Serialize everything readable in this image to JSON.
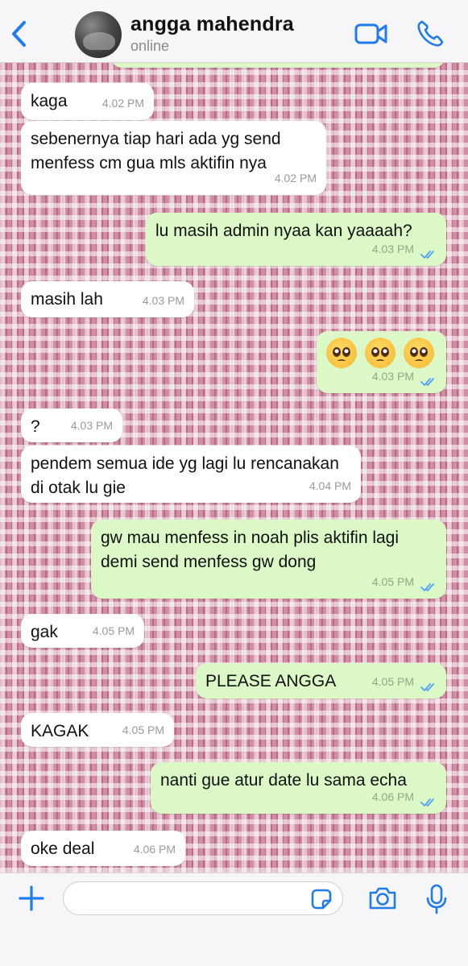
{
  "header": {
    "contact_name": "angga mahendra",
    "status": "online"
  },
  "colors": {
    "accent": "#1f7cf0",
    "outgoing_bubble": "#dcf8c6",
    "incoming_bubble": "#ffffff",
    "read_ticks": "#4fa3f7"
  },
  "icons": {
    "back": "chevron-left-icon",
    "video": "video-camera-icon",
    "phone": "phone-icon",
    "plus": "plus-icon",
    "sticker": "sticker-icon",
    "camera": "camera-icon",
    "mic": "microphone-icon"
  },
  "messages": [
    {
      "dir": "in",
      "text": "kaga",
      "time": "4.02 PM"
    },
    {
      "dir": "in",
      "text": "sebenernya tiap hari ada yg send menfess cm gua mls aktifin nya",
      "time": "4.02 PM"
    },
    {
      "dir": "out",
      "text": "lu masih admin nyaa kan yaaaah?",
      "time": "4.03 PM",
      "read": true
    },
    {
      "dir": "in",
      "text": "masih lah",
      "time": "4.03 PM"
    },
    {
      "dir": "out",
      "text": "🥺🥺🥺",
      "time": "4.03 PM",
      "read": true
    },
    {
      "dir": "in",
      "text": "?",
      "time": "4.03 PM"
    },
    {
      "dir": "in",
      "text": "pendem semua ide yg lagi lu rencanakan di otak lu gie",
      "time": "4.04 PM"
    },
    {
      "dir": "out",
      "text": "gw mau menfess in noah plis aktifin lagi demi send menfess gw dong",
      "time": "4.05 PM",
      "read": true
    },
    {
      "dir": "in",
      "text": "gak",
      "time": "4.05 PM"
    },
    {
      "dir": "out",
      "text": "PLEASE ANGGA",
      "time": "4.05 PM",
      "read": true
    },
    {
      "dir": "in",
      "text": "KAGAK",
      "time": "4.05 PM"
    },
    {
      "dir": "out",
      "text": "nanti gue atur date lu sama echa",
      "time": "4.06 PM",
      "read": true
    },
    {
      "dir": "in",
      "text": "oke deal",
      "time": "4.06 PM"
    }
  ],
  "composer": {
    "value": "",
    "placeholder": ""
  }
}
